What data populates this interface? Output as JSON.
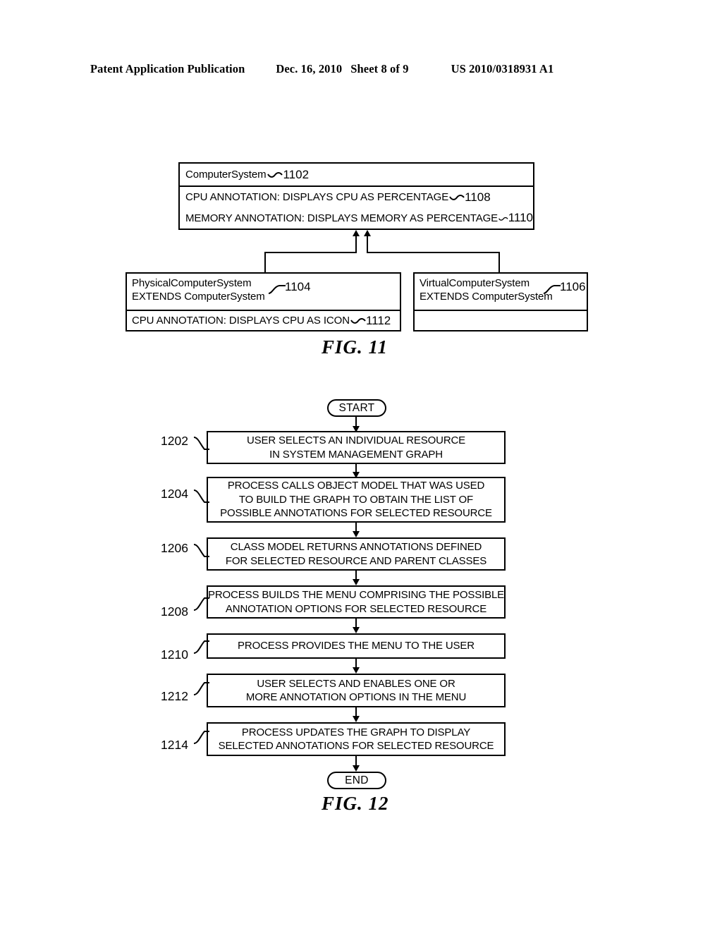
{
  "header": {
    "publication": "Patent Application Publication",
    "date": "Dec. 16, 2010",
    "sheet": "Sheet 8 of 9",
    "patent_number": "US 2010/0318931 A1"
  },
  "fig11": {
    "caption": "FIG. 11",
    "parent": {
      "title": "ComputerSystem",
      "title_ref": "1102",
      "annotations": [
        {
          "text": "CPU ANNOTATION: DISPLAYS CPU AS PERCENTAGE",
          "ref": "1108"
        },
        {
          "text": "MEMORY ANNOTATION: DISPLAYS MEMORY AS PERCENTAGE",
          "ref": "1110"
        }
      ]
    },
    "child_left": {
      "title_line1": "PhysicalComputerSystem",
      "title_line2": "EXTENDS ComputerSystem",
      "title_ref": "1104",
      "annotations": [
        {
          "text": "CPU ANNOTATION: DISPLAYS CPU AS ICON",
          "ref": "1112"
        }
      ]
    },
    "child_right": {
      "title_line1": "VirtualComputerSystem",
      "title_line2": "EXTENDS ComputerSystem",
      "title_ref": "1106",
      "annotations": [
        {
          "text": "",
          "ref": ""
        }
      ]
    }
  },
  "fig12": {
    "caption": "FIG. 12",
    "start_label": "START",
    "end_label": "END",
    "steps": [
      {
        "ref": "1202",
        "lines": [
          "USER SELECTS AN INDIVIDUAL RESOURCE",
          "IN SYSTEM MANAGEMENT GRAPH"
        ]
      },
      {
        "ref": "1204",
        "lines": [
          "PROCESS CALLS OBJECT MODEL THAT WAS USED",
          "TO BUILD THE GRAPH TO OBTAIN THE LIST OF",
          "POSSIBLE ANNOTATIONS FOR SELECTED RESOURCE"
        ]
      },
      {
        "ref": "1206",
        "lines": [
          "CLASS MODEL RETURNS ANNOTATIONS DEFINED",
          "FOR SELECTED RESOURCE AND PARENT CLASSES"
        ]
      },
      {
        "ref": "1208",
        "lines": [
          "PROCESS BUILDS THE MENU COMPRISING THE POSSIBLE",
          "ANNOTATION OPTIONS FOR SELECTED RESOURCE"
        ]
      },
      {
        "ref": "1210",
        "lines": [
          "PROCESS PROVIDES THE MENU TO THE USER"
        ]
      },
      {
        "ref": "1212",
        "lines": [
          "USER SELECTS AND ENABLES ONE OR",
          "MORE ANNOTATION OPTIONS IN THE MENU"
        ]
      },
      {
        "ref": "1214",
        "lines": [
          "PROCESS UPDATES THE GRAPH TO DISPLAY",
          "SELECTED ANNOTATIONS FOR SELECTED RESOURCE"
        ]
      }
    ]
  }
}
